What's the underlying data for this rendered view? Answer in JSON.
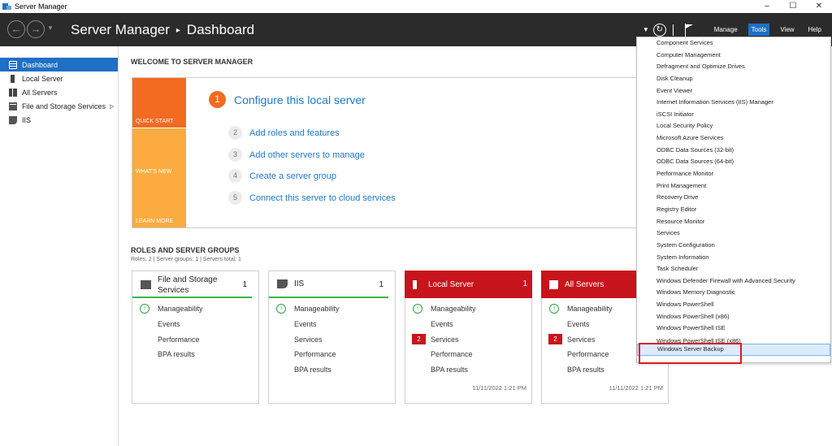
{
  "window": {
    "title": "Server Manager",
    "controls": [
      "–",
      "☐",
      "✕"
    ]
  },
  "header": {
    "breadcrumb_root": "Server Manager",
    "breadcrumb_sep": "▸",
    "breadcrumb_page": "Dashboard",
    "menu": {
      "manage": "Manage",
      "tools": "Tools",
      "view": "View",
      "help": "Help"
    }
  },
  "sidebar": {
    "items": [
      {
        "label": "Dashboard",
        "icon": "dashboard-icon",
        "active": true
      },
      {
        "label": "Local Server",
        "icon": "server-icon"
      },
      {
        "label": "All Servers",
        "icon": "servers-icon"
      },
      {
        "label": "File and Storage Services",
        "icon": "storage-icon",
        "expand": "▷"
      },
      {
        "label": "IIS",
        "icon": "iis-icon"
      }
    ]
  },
  "welcome": {
    "title": "WELCOME TO SERVER MANAGER",
    "tiles": [
      "QUICK START",
      "WHAT'S NEW",
      "LEARN MORE"
    ],
    "steps": [
      {
        "num": "1",
        "label": "Configure this local server"
      },
      {
        "num": "2",
        "label": "Add roles and features"
      },
      {
        "num": "3",
        "label": "Add other servers to manage"
      },
      {
        "num": "4",
        "label": "Create a server group"
      },
      {
        "num": "5",
        "label": "Connect this server to cloud services"
      }
    ]
  },
  "roles": {
    "title": "ROLES AND SERVER GROUPS",
    "subtitle": "Roles: 2   |   Server groups: 1   |   Servers total: 1",
    "cards": [
      {
        "name": "File and Storage Services",
        "count": "1",
        "rows": [
          "Manageability",
          "Events",
          "Performance",
          "BPA results"
        ],
        "timestamp": ""
      },
      {
        "name": "IIS",
        "count": "1",
        "rows": [
          "Manageability",
          "Events",
          "Services",
          "Performance",
          "BPA results"
        ],
        "timestamp": ""
      },
      {
        "name": "Local Server",
        "count": "1",
        "rows": [
          "Manageability",
          "Events",
          "Services",
          "Performance",
          "BPA results"
        ],
        "services_badge": "2",
        "timestamp": "11/11/2022 1:21 PM"
      },
      {
        "name": "All Servers",
        "count": "1",
        "rows": [
          "Manageability",
          "Events",
          "Services",
          "Performance",
          "BPA results"
        ],
        "services_badge": "2",
        "timestamp": "11/11/2022 1:21 PM"
      }
    ]
  },
  "tools_menu": {
    "items": [
      "Component Services",
      "Computer Management",
      "Defragment and Optimize Drives",
      "Disk Cleanup",
      "Event Viewer",
      "Internet Information Services (IIS) Manager",
      "iSCSI Initiator",
      "Local Security Policy",
      "Microsoft Azure Services",
      "ODBC Data Sources (32-bit)",
      "ODBC Data Sources (64-bit)",
      "Performance Monitor",
      "Print Management",
      "Recovery Drive",
      "Registry Editor",
      "Resource Monitor",
      "Services",
      "System Configuration",
      "System Information",
      "Task Scheduler",
      "Windows Defender Firewall with Advanced Security",
      "Windows Memory Diagnostic",
      "Windows PowerShell",
      "Windows PowerShell (x86)",
      "Windows PowerShell ISE",
      "Windows PowerShell ISE (x86)",
      "Windows Server Backup"
    ],
    "hovered_item": "Windows Server Backup"
  },
  "colors": {
    "accent": "#1f6fc5",
    "orange": "#f26b21",
    "amber": "#fbab3f",
    "alert_red": "#c8141c",
    "ok_green": "#2ba142"
  }
}
